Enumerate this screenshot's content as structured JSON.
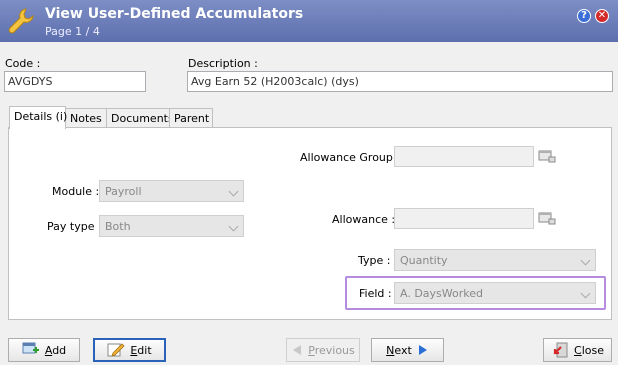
{
  "window": {
    "title": "View User-Defined Accumulators",
    "page": "Page 1 / 4",
    "help_icon": "question-circle-icon",
    "close_icon": "close-circle-icon"
  },
  "code": {
    "label": "Code :",
    "value": "AVGDYS"
  },
  "description": {
    "label": "Description :",
    "value": "Avg Earn 52 (H2003calc) (dys)"
  },
  "tabs": [
    {
      "label": "Details (i)",
      "active": true
    },
    {
      "label": "Notes"
    },
    {
      "label": "Documents"
    },
    {
      "label": "Parent"
    }
  ],
  "details": {
    "allowance_group": {
      "label": "Allowance Group :",
      "value": ""
    },
    "module": {
      "label": "Module :",
      "value": "Payroll"
    },
    "pay_type": {
      "label": "Pay type :",
      "value": "Both"
    },
    "allowance": {
      "label": "Allowance :",
      "value": ""
    },
    "type": {
      "label": "Type :",
      "value": "Quantity"
    },
    "field": {
      "label": "Field :",
      "value": "A. DaysWorked"
    }
  },
  "buttons": {
    "add": {
      "prefix": "",
      "underline": "A",
      "suffix": "dd"
    },
    "edit": {
      "prefix": "",
      "underline": "E",
      "suffix": "dit"
    },
    "previous": {
      "prefix": "",
      "underline": "P",
      "suffix": "revious"
    },
    "next": {
      "prefix": "",
      "underline": "N",
      "suffix": "ext"
    },
    "close": {
      "prefix": "",
      "underline": "C",
      "suffix": "lose"
    }
  },
  "colors": {
    "titlebar": "#6b7cb8",
    "highlight": "#b58ce0"
  }
}
